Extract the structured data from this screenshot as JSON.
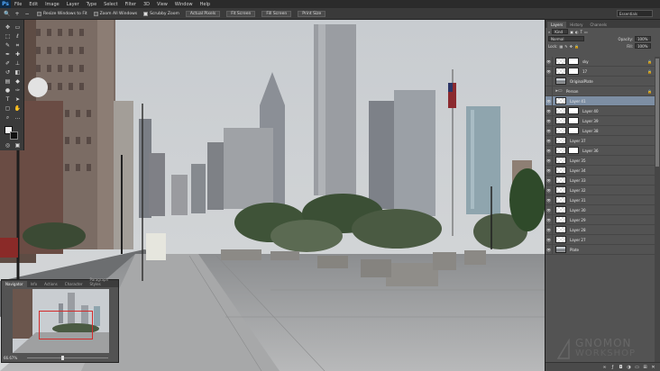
{
  "app": {
    "logo": "Ps"
  },
  "menu": [
    "File",
    "Edit",
    "Image",
    "Layer",
    "Type",
    "Select",
    "Filter",
    "3D",
    "View",
    "Window",
    "Help"
  ],
  "options_bar": {
    "resize_windows_label": "Resize Windows to Fit",
    "zoom_all_label": "Zoom All Windows",
    "scrubby_zoom_label": "Scrubby Zoom",
    "actual_pixels": "Actual Pixels",
    "fit_screen": "Fit Screen",
    "fill_screen": "Fill Screen",
    "print_size": "Print Size",
    "workspace": "Essentials"
  },
  "layers_panel": {
    "tabs": [
      "Layers",
      "History",
      "Channels"
    ],
    "kind_filter": "Kind",
    "blend_mode": "Normal",
    "opacity_label": "Opacity:",
    "opacity_value": "100%",
    "lock_label": "Lock:",
    "fill_label": "Fill:",
    "fill_value": "100%",
    "layers": [
      {
        "name": "sky",
        "type": "mask",
        "visible": true,
        "locked": true
      },
      {
        "name": "17",
        "type": "mask",
        "visible": true,
        "locked": true
      },
      {
        "name": "OriginalPlate",
        "type": "photo",
        "visible": false
      },
      {
        "name": "Person",
        "type": "folder",
        "visible": false,
        "locked": true
      },
      {
        "name": "Layer 41",
        "type": "transparent",
        "visible": true,
        "selected": true
      },
      {
        "name": "Layer 40",
        "type": "mask",
        "visible": true
      },
      {
        "name": "Layer 39",
        "type": "mask",
        "visible": true
      },
      {
        "name": "Layer 38",
        "type": "mask",
        "visible": true
      },
      {
        "name": "Layer 37",
        "type": "transparent",
        "visible": true
      },
      {
        "name": "Layer 36",
        "type": "mask",
        "visible": true
      },
      {
        "name": "Layer 35",
        "type": "transparent",
        "visible": true
      },
      {
        "name": "Layer 34",
        "type": "transparent",
        "visible": true
      },
      {
        "name": "Layer 33",
        "type": "transparent",
        "visible": true
      },
      {
        "name": "Layer 32",
        "type": "transparent",
        "visible": true
      },
      {
        "name": "Layer 31",
        "type": "transparent",
        "visible": true
      },
      {
        "name": "Layer 30",
        "type": "transparent",
        "visible": true
      },
      {
        "name": "Layer 29",
        "type": "transparent",
        "visible": true
      },
      {
        "name": "Layer 28",
        "type": "transparent",
        "visible": true
      },
      {
        "name": "Layer 27",
        "type": "transparent",
        "visible": true
      },
      {
        "name": "Plate",
        "type": "photo",
        "visible": true
      }
    ]
  },
  "navigator": {
    "tabs": [
      "Navigator",
      "Info",
      "Actions",
      "Character",
      "Paragraph Styles"
    ],
    "zoom": "66.67%"
  },
  "watermark": {
    "line1": "GNOMON",
    "line2": "WORKSHOP"
  }
}
